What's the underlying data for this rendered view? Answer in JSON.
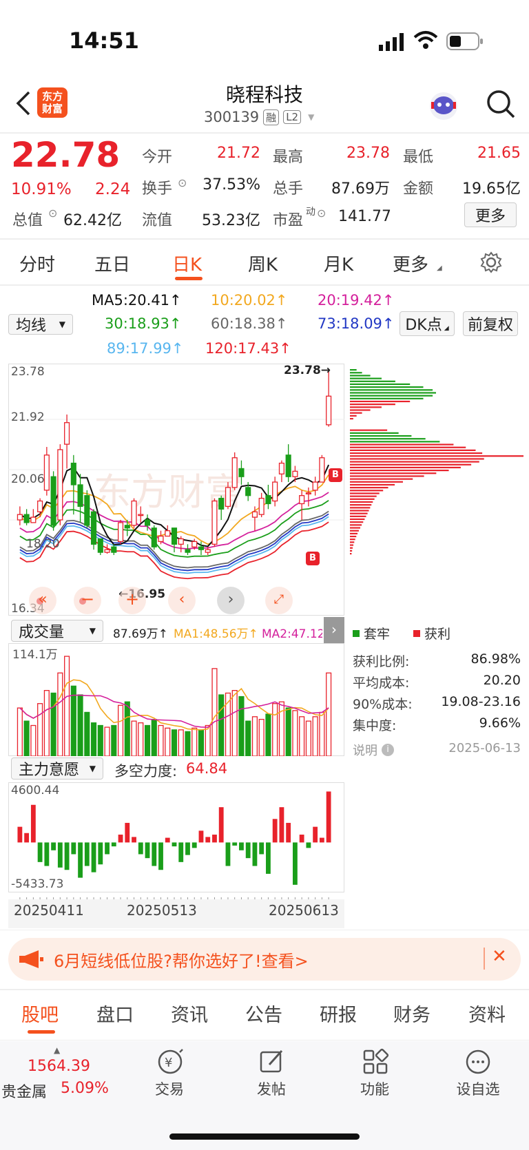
{
  "status_bar": {
    "time": "14:51"
  },
  "header": {
    "logo_line1": "东方",
    "logo_line2": "财富",
    "name": "晓程科技",
    "code": "300139",
    "tag_rong": "融",
    "tag_l2": "L2"
  },
  "quote": {
    "price": "22.78",
    "change_pct": "10.91%",
    "change": "2.24",
    "open_label": "今开",
    "open": "21.72",
    "high_label": "最高",
    "high": "23.78",
    "low_label": "最低",
    "low": "21.65",
    "turnover_label": "换手",
    "turnover": "37.53%",
    "volume_label": "总手",
    "volume": "87.69万",
    "amount_label": "金额",
    "amount": "19.65亿",
    "mktcap_label": "总值",
    "mktcap": "62.42亿",
    "float_label": "流值",
    "float": "53.23亿",
    "pe_label": "市盈",
    "pe_sup": "动",
    "pe": "141.77",
    "more_label": "更多"
  },
  "tabs": [
    "分时",
    "五日",
    "日K",
    "周K",
    "月K",
    "更多"
  ],
  "active_tab": "日K",
  "ma": {
    "selector": "均线",
    "ma5": "MA5:20.41↑",
    "ma10": "10:20.02↑",
    "ma20": "20:19.42↑",
    "ma30": "30:18.93↑",
    "ma60": "60:18.38↑",
    "ma73": "73:18.09↑",
    "ma89": "89:17.99↑",
    "ma120": "120:17.43↑",
    "dk_label": "DK点",
    "fq_label": "前复权"
  },
  "colors": {
    "up": "#e8222b",
    "down": "#1a9e1a",
    "ma5": "#111111",
    "ma10": "#f2a81f",
    "ma20": "#d4209c",
    "ma30": "#1a9e1a",
    "ma60": "#666666",
    "ma73": "#2238c4",
    "ma89": "#58b6ef",
    "ma120": "#e8222b",
    "accent": "#f4511e"
  },
  "kline": {
    "y_max": "23.78",
    "y_2": "21.92",
    "y_3": "20.06",
    "y_4": "18.20",
    "y_min": "16.34",
    "max_label": "23.78→",
    "min_label": "←16.95",
    "watermark": "东方财富",
    "b_marker": "B"
  },
  "chip": {
    "legend_trap": "套牢",
    "legend_profit": "获利",
    "rows": [
      {
        "label": "获利比例:",
        "value": "86.98%"
      },
      {
        "label": "平均成本:",
        "value": "20.20"
      },
      {
        "label": "90%成本:",
        "value": "19.08-23.16"
      },
      {
        "label": "集中度:",
        "value": "9.66%"
      }
    ],
    "note": "说明",
    "date": "2025-06-13"
  },
  "volume": {
    "selector": "成交量",
    "vol": "87.69万↑",
    "ma1": "MA1:48.56万↑",
    "ma2": "MA2:47.12万",
    "max": "114.1万"
  },
  "force": {
    "selector": "主力意愿",
    "label": "多空力度:",
    "value": "64.84",
    "max": "4600.44",
    "min": "-5433.73"
  },
  "dates": [
    "20250411",
    "20250513",
    "20250613"
  ],
  "banner": {
    "text": "6月短线低位股?帮你选好了!查看>"
  },
  "bottom_tabs": [
    "股吧",
    "盘口",
    "资讯",
    "公告",
    "研报",
    "财务",
    "资料"
  ],
  "nav": {
    "index_value": "1564.39",
    "index_name": "贵金属",
    "index_pct": "5.09%",
    "items": [
      "交易",
      "发帖",
      "功能",
      "设自选"
    ]
  },
  "chart_data": {
    "type": "candlestick",
    "title": "晓程科技 300139 日K",
    "ylim": [
      16.34,
      23.78
    ],
    "x_labels": [
      "20250411",
      "20250513",
      "20250613"
    ],
    "candles": [
      [
        18.2,
        18.7,
        18.0,
        18.4
      ],
      [
        18.4,
        18.6,
        18.0,
        18.1
      ],
      [
        18.1,
        18.6,
        18.1,
        18.3
      ],
      [
        18.5,
        19.0,
        18.3,
        18.9
      ],
      [
        19.3,
        20.9,
        19.1,
        20.6
      ],
      [
        19.8,
        20.0,
        17.8,
        18.0
      ],
      [
        18.2,
        21.0,
        18.0,
        20.8
      ],
      [
        21.0,
        22.1,
        20.1,
        21.8
      ],
      [
        20.3,
        20.6,
        18.4,
        19.5
      ],
      [
        19.5,
        19.9,
        18.1,
        18.7
      ],
      [
        19.1,
        19.3,
        17.9,
        18.0
      ],
      [
        18.5,
        18.6,
        17.1,
        17.3
      ],
      [
        17.5,
        17.5,
        16.9,
        17.0
      ],
      [
        17.0,
        17.3,
        16.95,
        17.1
      ],
      [
        17.2,
        17.3,
        16.9,
        17.0
      ],
      [
        17.4,
        18.2,
        17.3,
        18.1
      ],
      [
        18.0,
        18.2,
        17.6,
        17.9
      ],
      [
        18.0,
        19.0,
        17.9,
        18.9
      ],
      [
        18.4,
        18.7,
        18.1,
        18.4
      ],
      [
        18.2,
        18.4,
        17.8,
        18.0
      ],
      [
        17.9,
        18.0,
        17.1,
        17.2
      ],
      [
        17.4,
        17.8,
        17.3,
        17.6
      ],
      [
        17.6,
        18.0,
        17.6,
        17.8
      ],
      [
        17.9,
        17.9,
        17.0,
        17.3
      ],
      [
        17.3,
        17.6,
        17.0,
        17.5
      ],
      [
        17.1,
        17.3,
        16.9,
        17.0
      ],
      [
        17.2,
        17.5,
        17.1,
        17.4
      ],
      [
        17.2,
        17.4,
        16.9,
        17.1
      ],
      [
        17.0,
        17.2,
        16.9,
        17.1
      ],
      [
        17.3,
        19.0,
        17.2,
        18.9
      ],
      [
        19.0,
        19.1,
        18.2,
        18.6
      ],
      [
        18.7,
        19.6,
        18.6,
        19.4
      ],
      [
        19.4,
        20.7,
        19.3,
        20.5
      ],
      [
        20.1,
        20.4,
        19.5,
        19.8
      ],
      [
        19.4,
        19.6,
        18.9,
        19.1
      ],
      [
        18.3,
        18.7,
        17.8,
        18.5
      ],
      [
        18.4,
        19.2,
        18.3,
        19.0
      ],
      [
        19.1,
        19.5,
        18.6,
        18.8
      ],
      [
        18.9,
        19.8,
        18.7,
        19.6
      ],
      [
        19.9,
        20.4,
        19.6,
        20.3
      ],
      [
        20.6,
        21.0,
        19.6,
        19.8
      ],
      [
        19.8,
        20.2,
        19.6,
        20.0
      ],
      [
        18.8,
        19.3,
        18.2,
        19.1
      ],
      [
        19.2,
        19.4,
        18.7,
        19.2
      ],
      [
        19.3,
        19.8,
        19.1,
        19.6
      ],
      [
        19.6,
        20.6,
        19.6,
        20.5
      ],
      [
        21.72,
        23.78,
        21.65,
        22.78
      ]
    ],
    "ma_last": {
      "MA5": 20.41,
      "MA10": 20.02,
      "MA20": 19.42,
      "MA30": 18.93,
      "MA60": 18.38,
      "MA73": 18.09,
      "MA89": 17.99,
      "MA120": 17.43
    }
  }
}
